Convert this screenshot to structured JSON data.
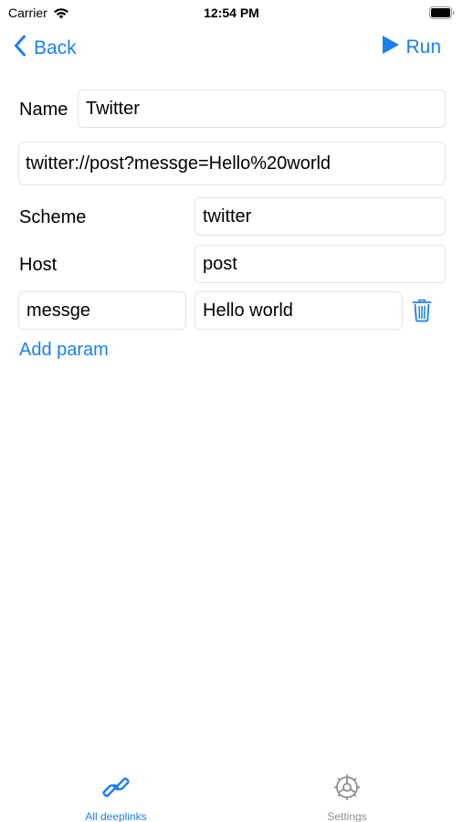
{
  "status_bar": {
    "carrier": "Carrier",
    "time": "12:54 PM"
  },
  "nav": {
    "back_label": "Back",
    "run_label": "Run",
    "accent_color": "#1a7ff0"
  },
  "form": {
    "name_label": "Name",
    "name_value": "Twitter",
    "url_value": "twitter://post?messge=Hello%20world",
    "scheme_label": "Scheme",
    "scheme_value": "twitter",
    "host_label": "Host",
    "host_value": "post",
    "params": [
      {
        "key": "messge",
        "value": "Hello world"
      }
    ],
    "add_param_label": "Add param"
  },
  "tab_bar": {
    "tabs": [
      {
        "label": "All deeplinks",
        "icon": "link-icon",
        "active": true
      },
      {
        "label": "Settings",
        "icon": "settings-gear-icon",
        "active": false
      }
    ]
  }
}
